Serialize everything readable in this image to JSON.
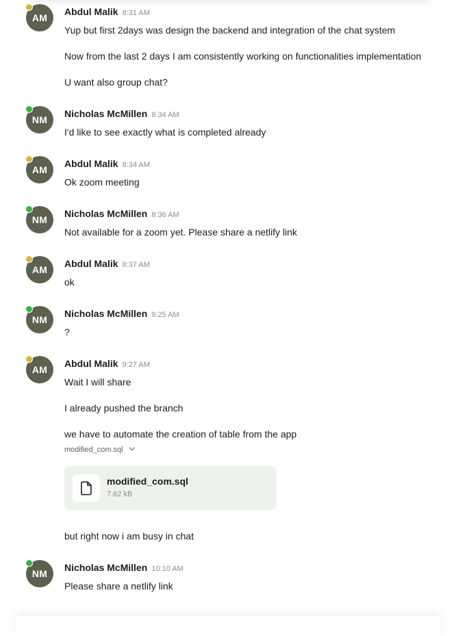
{
  "messages": [
    {
      "initials": "AM",
      "status": "away",
      "author": "Abdul Malik",
      "time": "8:31 AM",
      "lines": [
        "Yup but first 2days was design the backend and integration of the chat system",
        "Now from the last 2 days I am consistently working on functionalities implementation",
        "U want also group chat?"
      ]
    },
    {
      "initials": "NM",
      "status": "online",
      "author": "Nicholas McMillen",
      "time": "8:34 AM",
      "lines": [
        "I'd like to see exactly what is completed already"
      ]
    },
    {
      "initials": "AM",
      "status": "away",
      "author": "Abdul Malik",
      "time": "8:34 AM",
      "lines": [
        "Ok zoom meeting"
      ]
    },
    {
      "initials": "NM",
      "status": "online",
      "author": "Nicholas McMillen",
      "time": "8:36 AM",
      "lines": [
        "Not available for a zoom yet. Please share a netlify link"
      ]
    },
    {
      "initials": "AM",
      "status": "away",
      "author": "Abdul Malik",
      "time": "8:37 AM",
      "lines": [
        "ok"
      ]
    },
    {
      "initials": "NM",
      "status": "online",
      "author": "Nicholas McMillen",
      "time": "9:25 AM",
      "lines": [
        "?"
      ]
    },
    {
      "initials": "AM",
      "status": "away",
      "author": "Abdul Malik",
      "time": "9:27 AM",
      "lines": [
        "Wait I will share",
        "I already pushed the branch",
        "we have to automate the creation of table from the app"
      ],
      "attachment": {
        "toggle_label": "modified_com.sql",
        "file_name": "modified_com.sql",
        "file_size": "7.62 kB",
        "icon": "file-icon"
      },
      "after_lines": [
        "but right now i am busy in chat"
      ]
    },
    {
      "initials": "NM",
      "status": "online",
      "author": "Nicholas McMillen",
      "time": "10:10 AM",
      "lines": [
        "Please share a netlify link"
      ]
    }
  ],
  "colors": {
    "avatar_bg": "#5c6150",
    "away": "#d9b53f",
    "online": "#3fae49",
    "attachment_bg": "#eef2ec"
  }
}
